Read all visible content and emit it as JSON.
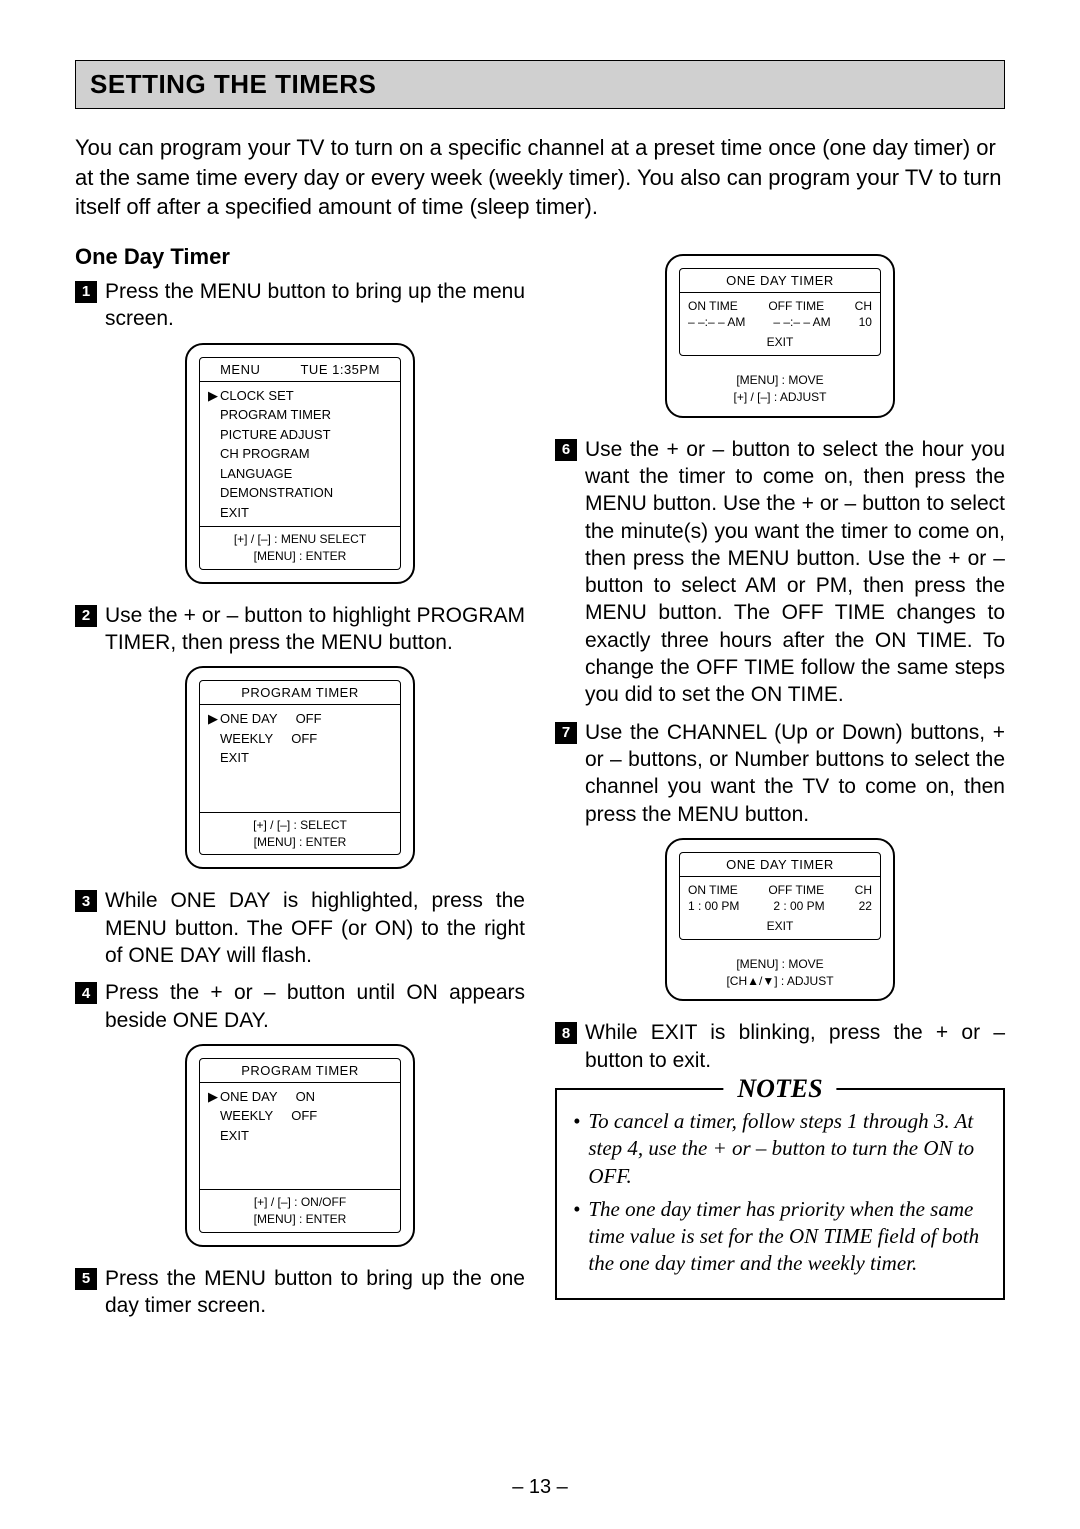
{
  "header": "SETTING THE TIMERS",
  "intro": "You can program your TV to turn on a specific channel at a preset time once (one day timer) or at the same time every day or every week (weekly timer). You also can program your TV to turn itself off after a specified amount of time (sleep timer).",
  "subhead": "One Day Timer",
  "steps": {
    "s1": "Press the MENU button to bring up the menu screen.",
    "s2": "Use the + or – button to highlight PROGRAM TIMER, then press the MENU button.",
    "s3": "While ONE DAY is highlighted, press the MENU button. The OFF (or ON) to the right of ONE DAY will flash.",
    "s4": "Press the + or – button until ON appears beside ONE DAY.",
    "s5": "Press the MENU button to bring up the one day timer screen.",
    "s6": "Use the + or – button to select the hour you want the timer to come on, then press the MENU button. Use the + or – button to select the minute(s) you want the timer to come on, then press the MENU button. Use the + or – button to select AM or PM, then press the MENU button. The OFF TIME changes to exactly three hours after the ON TIME. To change the OFF TIME follow the same steps you did to set the ON TIME.",
    "s7": "Use the CHANNEL (Up or Down) buttons, + or – buttons, or Number buttons to select the channel you want the TV to come on, then press the MENU button.",
    "s8": "While EXIT is blinking, press the + or – button to exit."
  },
  "osd_menu": {
    "title_left": "MENU",
    "title_right": "TUE 1:35PM",
    "items": [
      "CLOCK SET",
      "PROGRAM TIMER",
      "PICTURE ADJUST",
      "CH PROGRAM",
      "LANGUAGE",
      "DEMONSTRATION",
      "EXIT"
    ],
    "help1": "[+] / [–]  : MENU SELECT",
    "help2": "[MENU] : ENTER"
  },
  "osd_pt_off": {
    "title": "PROGRAM TIMER",
    "row1a": "ONE DAY",
    "row1b": "OFF",
    "row2a": "WEEKLY",
    "row2b": "OFF",
    "row3": "EXIT",
    "help1": "[+] / [–]  : SELECT",
    "help2": "[MENU] : ENTER"
  },
  "osd_pt_on": {
    "title": "PROGRAM TIMER",
    "row1a": "ONE DAY",
    "row1b": "ON",
    "row2a": "WEEKLY",
    "row2b": "OFF",
    "row3": "EXIT",
    "help1": "[+] / [–]  : ON/OFF",
    "help2": "[MENU] : ENTER"
  },
  "osd_odt1": {
    "title": "ONE DAY TIMER",
    "h1": "ON TIME",
    "h2": "OFF TIME",
    "h3": "CH",
    "v1": "– –:– – AM",
    "v2": "– –:– – AM",
    "v3": "10",
    "exit": "EXIT",
    "help1": "[MENU] : MOVE",
    "help2": "[+] / [–]  : ADJUST"
  },
  "osd_odt2": {
    "title": "ONE DAY TIMER",
    "h1": "ON TIME",
    "h2": "OFF TIME",
    "h3": "CH",
    "v1": "1 : 00 PM",
    "v2": "2 : 00 PM",
    "v3": "22",
    "exit": "EXIT",
    "help1": "[MENU]  : MOVE",
    "help2": "[CH▲/▼]  : ADJUST"
  },
  "notes": {
    "title": "NOTES",
    "n1": "To cancel a timer, follow steps 1 through 3. At step 4, use the + or – button to turn the ON to OFF.",
    "n2": "The one day timer has priority when the same time value is set for the ON TIME field of both the one day timer and the weekly timer."
  },
  "page": "– 13 –"
}
